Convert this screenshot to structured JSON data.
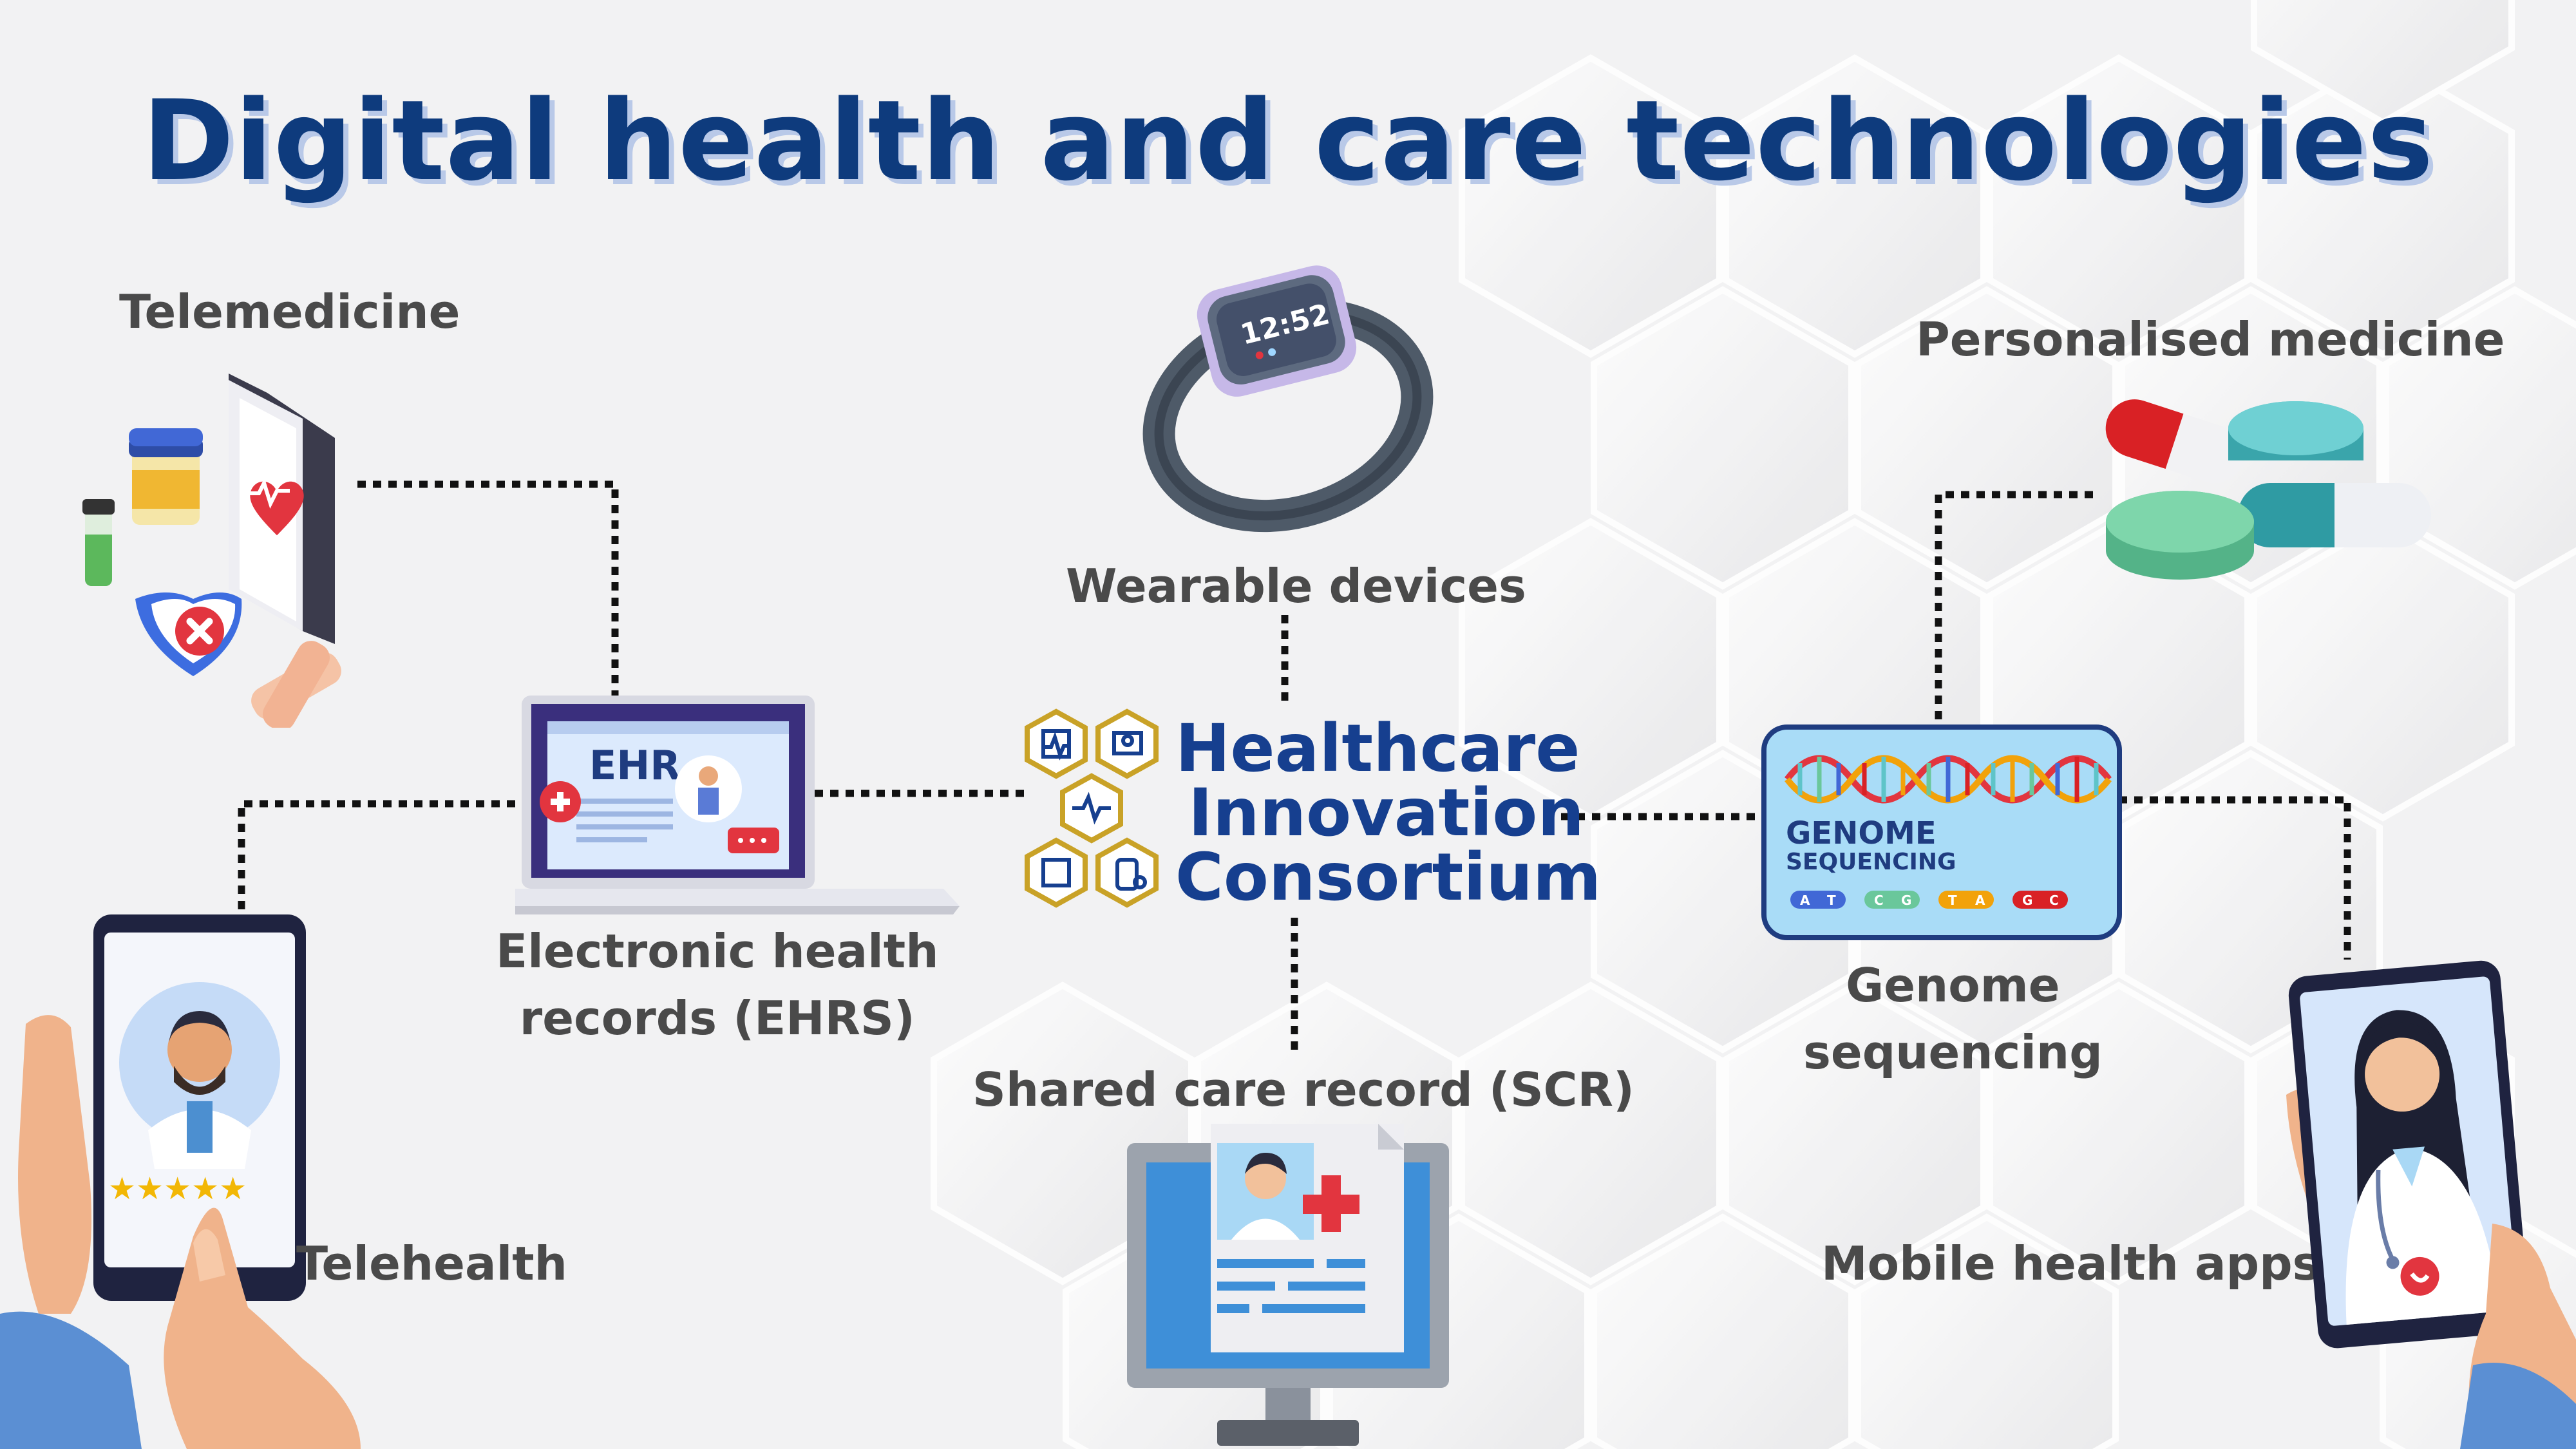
{
  "title": "Digital health and care technologies",
  "logo": {
    "line1": "Healthcare",
    "line2": "Innovation",
    "line3": "Consortium"
  },
  "nodes": {
    "telemedicine": "Telemedicine",
    "ehrs_line1": "Electronic health",
    "ehrs_line2": "records (EHRS)",
    "telehealth": "Telehealth",
    "wearable": "Wearable devices",
    "scr": "Shared care record (SCR)",
    "personalised": "Personalised medicine",
    "genome_line1": "Genome",
    "genome_line2": "sequencing",
    "mobile": "Mobile health apps"
  },
  "illustrations": {
    "laptop_screen_text": "EHR",
    "watch_time": "12:52",
    "genome_card_line1": "GENOME",
    "genome_card_line2": "SEQUENCING",
    "genome_bases": [
      "A",
      "T",
      "C",
      "G",
      "T",
      "A",
      "G",
      "C"
    ],
    "rating_stars": "★★★★★"
  },
  "colors": {
    "title": "#0e3b7d",
    "logo_text": "#163f8f",
    "logo_gold": "#c9a227",
    "label_text": "#4a4a4a",
    "connector": "#111111",
    "background": "#f2f2f3"
  },
  "icons": [
    "tablet-heart-icon",
    "laptop-ehr-icon",
    "phone-doctor-icon",
    "smartwatch-icon",
    "monitor-patient-icon",
    "pills-icon",
    "dna-card-icon",
    "phone-female-doctor-icon"
  ]
}
